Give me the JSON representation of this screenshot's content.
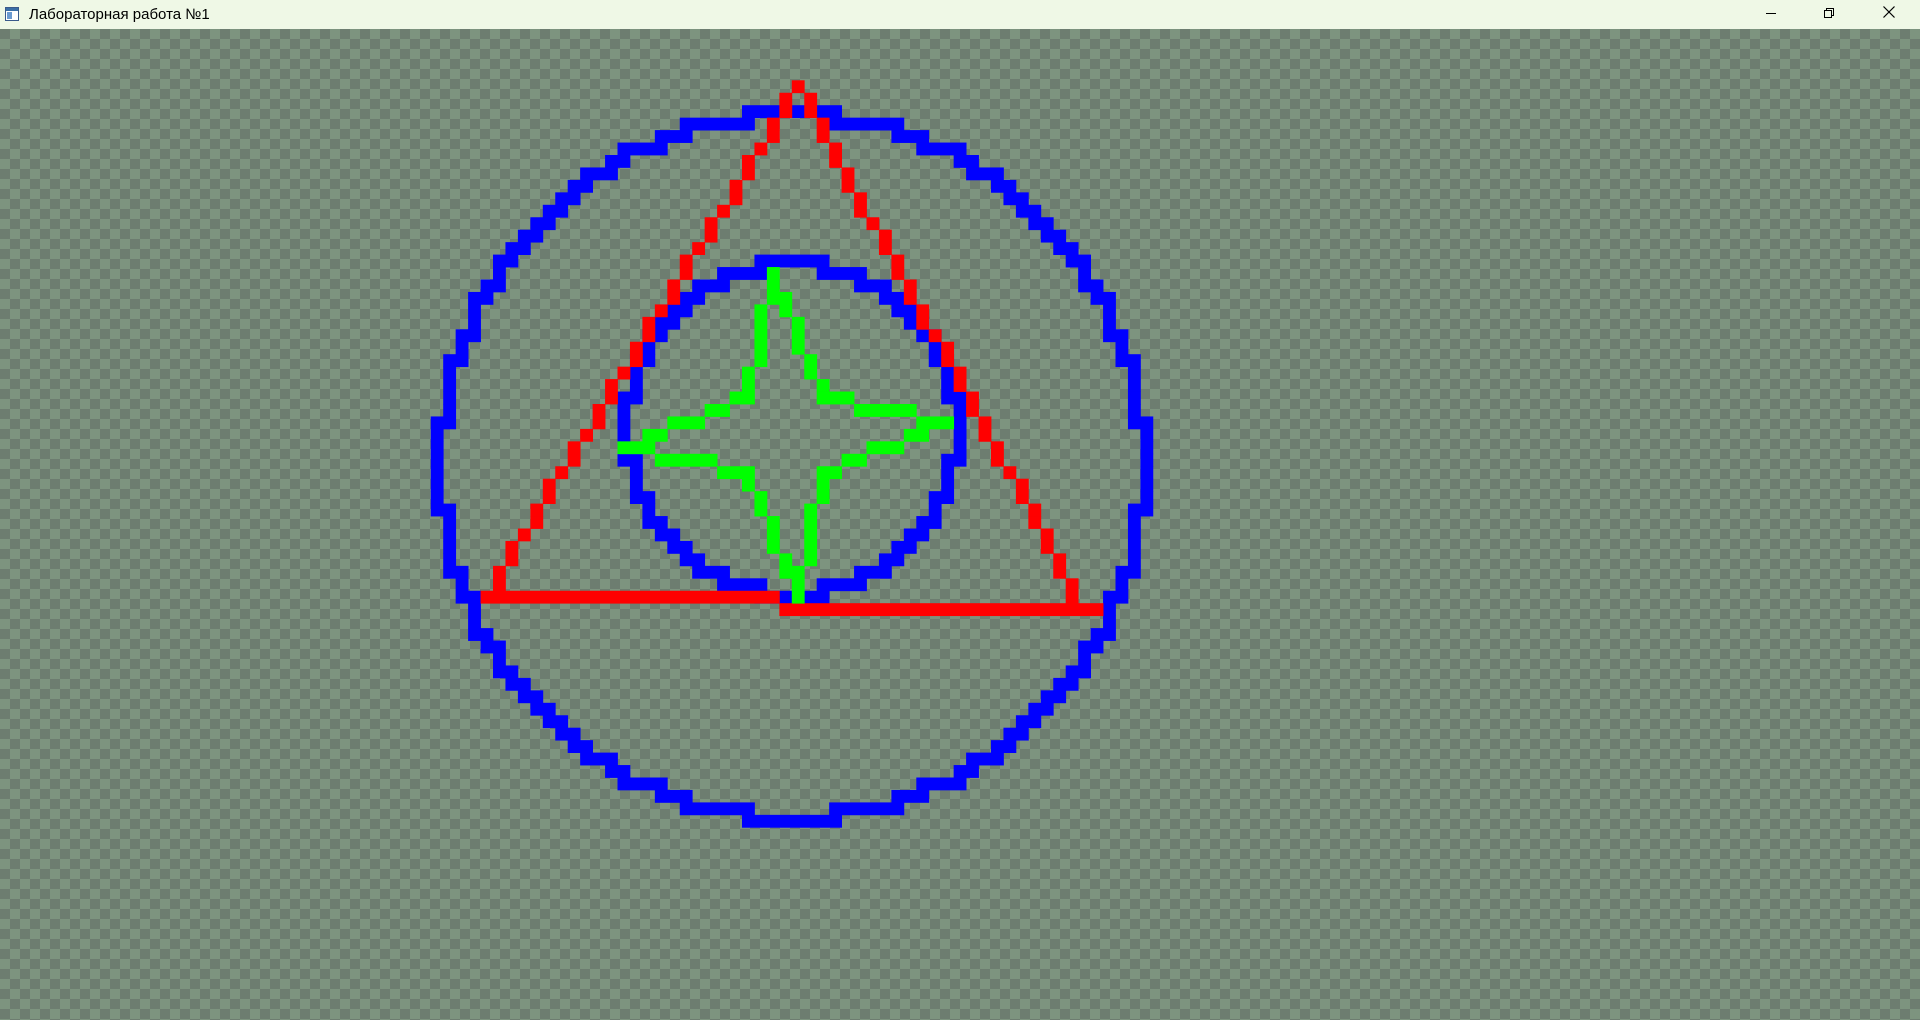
{
  "window": {
    "title": "Лабораторная работа №1",
    "icon": "app-window-icon"
  },
  "controls": {
    "minimize": "minimize-icon",
    "restore": "restore-icon",
    "close": "close-icon"
  },
  "colors": {
    "titlebar_bg": "#eff8e6",
    "checker_light": "#7d947f",
    "checker_dark": "#6d7d70",
    "outer_circle": "#0000ff",
    "inner_circle": "#0000ff",
    "triangle": "#ff0000",
    "star": "#00ff00"
  }
}
